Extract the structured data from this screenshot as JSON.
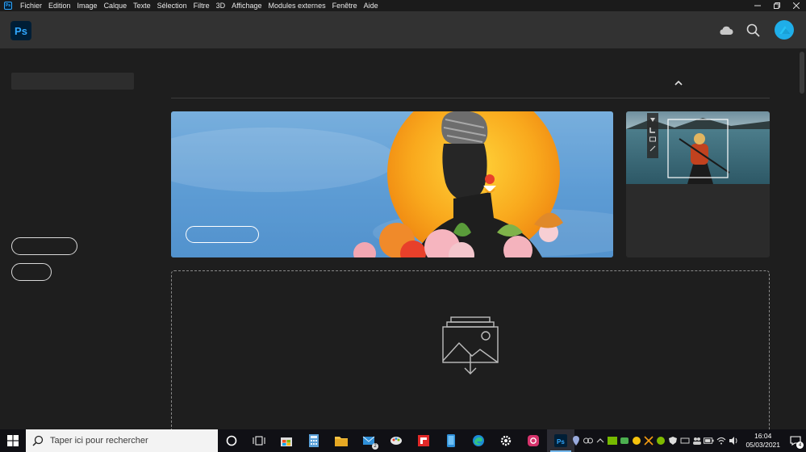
{
  "menubar": {
    "app_icon": "ps-small-icon",
    "items": [
      "Fichier",
      "Edition",
      "Image",
      "Calque",
      "Texte",
      "Sélection",
      "Filtre",
      "3D",
      "Affichage",
      "Modules externes",
      "Fenêtre",
      "Aide"
    ],
    "window_controls": [
      "minimize-icon",
      "restore-icon",
      "close-icon"
    ]
  },
  "header": {
    "logo_text": "Ps",
    "icons": [
      "cloud-icon",
      "search-icon",
      "avatar"
    ],
    "accent": "#31a8ff",
    "avatar_color": "#1faee9"
  },
  "main": {
    "banner_colors": {
      "sky": "#5d9bd4",
      "sun": "#f7a81b"
    },
    "dropzone_icon": "import-images-icon"
  },
  "taskbar": {
    "search_placeholder": "Taper ici pour rechercher",
    "mail_badge": "2",
    "time": "16:04",
    "date": "05/03/2021",
    "notification_count": "4"
  }
}
